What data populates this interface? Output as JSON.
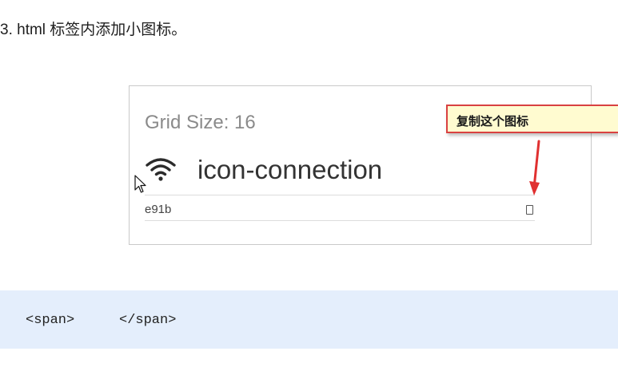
{
  "doc": {
    "heading": "3. html 标签内添加小图标。"
  },
  "icon_card": {
    "grid_size_label": "Grid Size: 16",
    "icon_glyph": "wifi-icon",
    "icon_name": "icon-connection",
    "unicode_code": "e91b",
    "copy_glyph": "square-glyph-icon"
  },
  "annotation": {
    "callout_text": "复制这个图标",
    "colors": {
      "border": "#d94141",
      "fill": "#fffbd0",
      "arrow": "#e03030"
    }
  },
  "code_block": {
    "open_tag": "<span>",
    "close_tag": "</span>",
    "background": "#e4eefc"
  }
}
